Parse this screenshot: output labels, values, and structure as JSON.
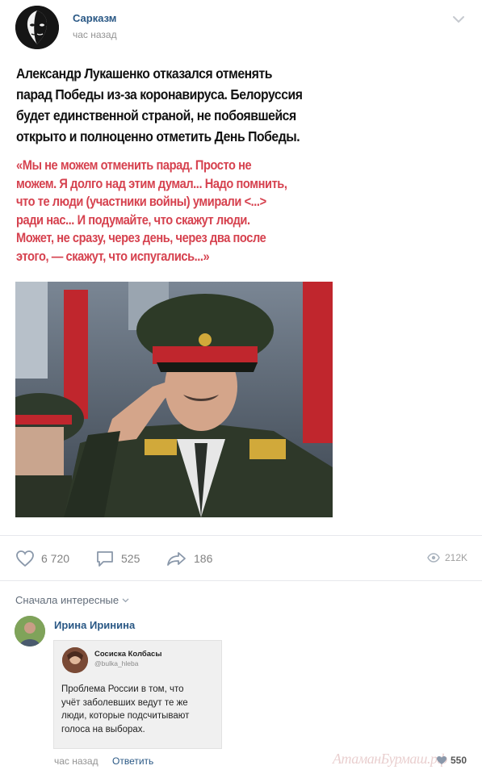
{
  "post": {
    "group_name": "Сарказм",
    "time": "час назад",
    "headline": "Александр Лукашенко отказался отменять\nпарад Победы из-за коронавируса. Белоруссия\nбудет единственной страной, не побоявшейся\nоткрыто и полноценно отметить День Победы.",
    "quote": "«Мы не можем отменить парад. Просто не\nможем. Я долго над этим думал... Надо помнить,\nчто те люди (участники войны) умирали <...>\nради нас... И подумайте, что скажут люди.\nМожет, не сразу, через день, через два после\nэтого, — скажут, что испугались...»"
  },
  "actions": {
    "likes": "6 720",
    "comments": "525",
    "shares": "186",
    "views": "212K"
  },
  "comments_section": {
    "sort_label": "Сначала интересные"
  },
  "comment": {
    "author": "Ирина Иринина",
    "time": "час назад",
    "reply_label": "Ответить",
    "likes": "550",
    "tweet": {
      "name": "Сосиска Колбасы",
      "handle": "@bulka_hleba",
      "text": "Проблема России в том, что\nучёт заболевших ведут те же\nлюди, которые подсчитывают\nголоса на выборах."
    }
  },
  "watermark": "АтаманБурмаш.рф",
  "colors": {
    "link": "#2a5885",
    "quote_red": "#d6424f",
    "muted": "#939393"
  }
}
